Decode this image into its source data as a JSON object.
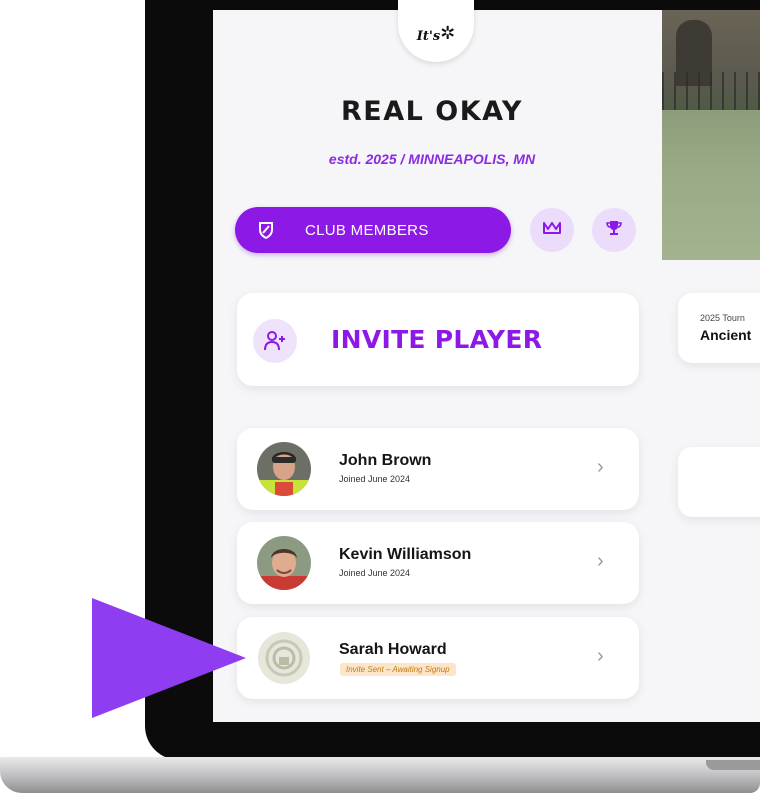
{
  "club": {
    "logo_text": "It's",
    "name": "REAL OKAY",
    "subtitle": "estd. 2025 / MINNEAPOLIS, MN"
  },
  "tabs": {
    "members_label": "CLUB MEMBERS",
    "members_icon": "shield-icon",
    "second_icon": "crown-icon",
    "third_icon": "trophy-icon"
  },
  "invite": {
    "label": "INVITE PLAYER",
    "icon": "add-user-icon"
  },
  "members": [
    {
      "name": "John Brown",
      "status": "Joined June 2024"
    },
    {
      "name": "Kevin Williamson",
      "status": "Joined June 2024"
    },
    {
      "name": "Sarah Howard",
      "status": "Invite Sent – Awaiting Signup"
    }
  ],
  "tournament": {
    "label": "2025 Tourn",
    "name": "Ancient"
  },
  "colors": {
    "accent": "#8d19e6",
    "accent_light": "#ecdcfb",
    "pending_badge": "#fde6c8",
    "pointer": "#8f3df0"
  }
}
